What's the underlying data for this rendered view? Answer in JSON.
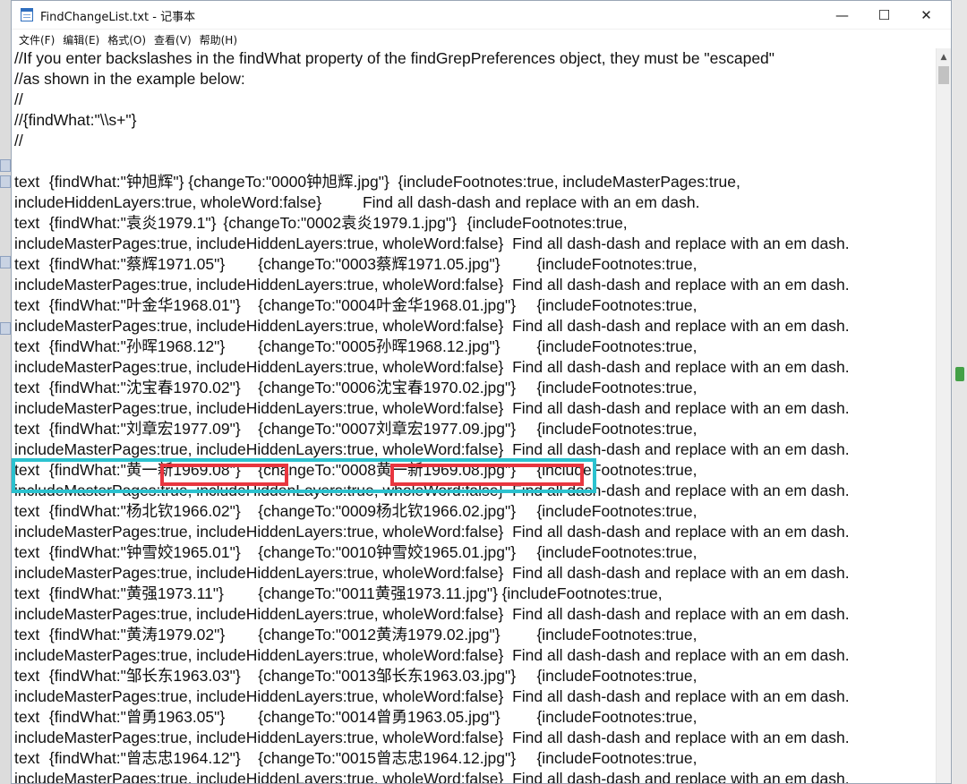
{
  "window": {
    "title": "FindChangeList.txt - 记事本",
    "controls": {
      "minimize": "—",
      "maximize": "☐",
      "close": "✕"
    }
  },
  "menu": [
    "文件(F)",
    "编辑(E)",
    "格式(O)",
    "查看(V)",
    "帮助(H)"
  ],
  "editor": {
    "lines": [
      "//If you enter backslashes in the findWhat property of the findGrepPreferences object, they must be \"escaped\"",
      "//as shown in the example below:",
      "//",
      "//{findWhat:\"\\\\s+\"}",
      "//",
      "",
      "text\t{findWhat:\"钟旭辉\"} {changeTo:\"0000钟旭辉.jpg\"}  {includeFootnotes:true, includeMasterPages:true,",
      "includeHiddenLayers:true, wholeWord:false}\t\tFind all dash-dash and replace with an em dash.",
      "text\t{findWhat:\"袁炎1979.1\"}\t{changeTo:\"0002袁炎1979.1.jpg\"}\t{includeFootnotes:true,",
      "includeMasterPages:true, includeHiddenLayers:true, wholeWord:false}  Find all dash-dash and replace with an em dash.",
      "text\t{findWhat:\"蔡辉1971.05\"}\t{changeTo:\"0003蔡辉1971.05.jpg\"}\t{includeFootnotes:true,",
      "includeMasterPages:true, includeHiddenLayers:true, wholeWord:false}  Find all dash-dash and replace with an em dash.",
      "text\t{findWhat:\"叶金华1968.01\"}\t{changeTo:\"0004叶金华1968.01.jpg\"}\t{includeFootnotes:true,",
      "includeMasterPages:true, includeHiddenLayers:true, wholeWord:false}  Find all dash-dash and replace with an em dash.",
      "text\t{findWhat:\"孙晖1968.12\"}\t{changeTo:\"0005孙晖1968.12.jpg\"}\t{includeFootnotes:true,",
      "includeMasterPages:true, includeHiddenLayers:true, wholeWord:false}  Find all dash-dash and replace with an em dash.",
      "text\t{findWhat:\"沈宝春1970.02\"}\t{changeTo:\"0006沈宝春1970.02.jpg\"}\t{includeFootnotes:true,",
      "includeMasterPages:true, includeHiddenLayers:true, wholeWord:false}  Find all dash-dash and replace with an em dash.",
      "text\t{findWhat:\"刘章宏1977.09\"}\t{changeTo:\"0007刘章宏1977.09.jpg\"}\t{includeFootnotes:true,",
      "includeMasterPages:true, includeHiddenLayers:true, wholeWord:false}  Find all dash-dash and replace with an em dash.",
      "text\t{findWhat:\"黄一新1969.08\"}\t{changeTo:\"0008黄一新1969.08.jpg\"}\t{includeFootnotes:true,",
      "includeMasterPages:true, includeHiddenLayers:true, wholeWord:false}  Find all dash-dash and replace with an em dash.",
      "text\t{findWhat:\"杨北钦1966.02\"}\t{changeTo:\"0009杨北钦1966.02.jpg\"}\t{includeFootnotes:true,",
      "includeMasterPages:true, includeHiddenLayers:true, wholeWord:false}  Find all dash-dash and replace with an em dash.",
      "text\t{findWhat:\"钟雪姣1965.01\"}\t{changeTo:\"0010钟雪姣1965.01.jpg\"}\t{includeFootnotes:true,",
      "includeMasterPages:true, includeHiddenLayers:true, wholeWord:false}  Find all dash-dash and replace with an em dash.",
      "text\t{findWhat:\"黄强1973.11\"}\t{changeTo:\"0011黄强1973.11.jpg\"}\t{includeFootnotes:true,",
      "includeMasterPages:true, includeHiddenLayers:true, wholeWord:false}  Find all dash-dash and replace with an em dash.",
      "text\t{findWhat:\"黄涛1979.02\"}\t{changeTo:\"0012黄涛1979.02.jpg\"}\t{includeFootnotes:true,",
      "includeMasterPages:true, includeHiddenLayers:true, wholeWord:false}  Find all dash-dash and replace with an em dash.",
      "text\t{findWhat:\"邹长东1963.03\"}\t{changeTo:\"0013邹长东1963.03.jpg\"}\t{includeFootnotes:true,",
      "includeMasterPages:true, includeHiddenLayers:true, wholeWord:false}  Find all dash-dash and replace with an em dash.",
      "text\t{findWhat:\"曾勇1963.05\"}\t{changeTo:\"0014曾勇1963.05.jpg\"}\t{includeFootnotes:true,",
      "includeMasterPages:true, includeHiddenLayers:true, wholeWord:false}  Find all dash-dash and replace with an em dash.",
      "text\t{findWhat:\"曾志忠1964.12\"}\t{changeTo:\"0015曾志忠1964.12.jpg\"}\t{includeFootnotes:true,",
      "includeMasterPages:true, includeHiddenLayers:true, wholeWord:false}  Find all dash-dash and replace with an em dash."
    ]
  },
  "annotations": {
    "row_highlight_color": "#2bc2cf",
    "field_highlight_color": "#e8363f"
  }
}
